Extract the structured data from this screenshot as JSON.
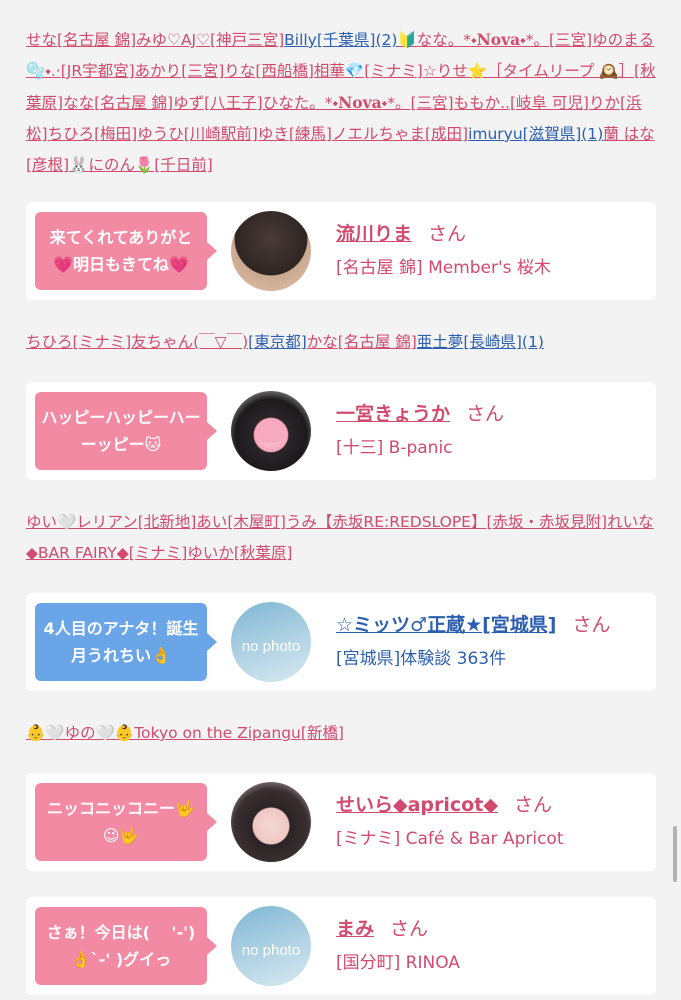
{
  "rows": [
    {
      "names": [
        {
          "text": "せな",
          "kind": "plain"
        },
        {
          "text": "[名古屋 錦]",
          "kind": "link"
        },
        {
          "text": "みゆ♡AJ♡",
          "kind": "plain"
        },
        {
          "text": "[神戸三宮]",
          "kind": "link"
        },
        {
          "text": "Billy",
          "kind": "blue"
        },
        {
          "text": "[千葉県]",
          "kind": "blue"
        },
        {
          "text": "(2)",
          "kind": "blue"
        },
        {
          "text": "🔰なな。*⬩",
          "kind": "plain"
        },
        {
          "text": "Nova",
          "kind": "bold"
        },
        {
          "text": "⬩*。",
          "kind": "plain"
        },
        {
          "text": "[三宮]",
          "kind": "link"
        },
        {
          "text": "ゆのまる 🫧⬩.·",
          "kind": "plain"
        },
        {
          "text": "[JR宇都宮]",
          "kind": "link"
        },
        {
          "text": "あかり",
          "kind": "plain"
        },
        {
          "text": "[三宮]",
          "kind": "link"
        },
        {
          "text": "りな",
          "kind": "plain"
        },
        {
          "text": "[西船橋]",
          "kind": "link"
        },
        {
          "text": "相華💎",
          "kind": "plain"
        },
        {
          "text": "[ミナミ]",
          "kind": "link"
        },
        {
          "text": "☆りせ⭐",
          "kind": "plain"
        },
        {
          "text": "［タイムリープ 🕰️］",
          "kind": "link"
        },
        {
          "text": "[秋葉原]",
          "kind": "link"
        },
        {
          "text": "なな",
          "kind": "plain"
        },
        {
          "text": "[名古屋 錦]",
          "kind": "link"
        },
        {
          "text": "ゆず",
          "kind": "plain"
        },
        {
          "text": "[八王子]",
          "kind": "link"
        },
        {
          "text": "ひなた。*⬩",
          "kind": "plain"
        },
        {
          "text": "Nova",
          "kind": "bold"
        },
        {
          "text": "⬩*。",
          "kind": "plain"
        },
        {
          "text": "[三宮]",
          "kind": "link"
        },
        {
          "text": "ももか..",
          "kind": "plain"
        },
        {
          "text": "[岐阜 可児]",
          "kind": "link"
        },
        {
          "text": "りか",
          "kind": "plain"
        },
        {
          "text": "[浜松]",
          "kind": "link"
        },
        {
          "text": "ちひろ",
          "kind": "plain"
        },
        {
          "text": "[梅田]",
          "kind": "link"
        },
        {
          "text": "ゆうひ",
          "kind": "plain"
        },
        {
          "text": "[川崎駅前]",
          "kind": "link"
        },
        {
          "text": "ゆき",
          "kind": "plain"
        },
        {
          "text": "[練馬]",
          "kind": "link"
        },
        {
          "text": "ノエルちゃま",
          "kind": "plain"
        },
        {
          "text": "[成田]",
          "kind": "link"
        },
        {
          "text": "imuryu",
          "kind": "blue"
        },
        {
          "text": "[滋賀県]",
          "kind": "blue"
        },
        {
          "text": "(1)",
          "kind": "blue"
        },
        {
          "text": "蘭 はな",
          "kind": "plain"
        },
        {
          "text": "[彦根]",
          "kind": "link"
        },
        {
          "text": "🐰にのん🌷",
          "kind": "plain"
        },
        {
          "text": "[千日前]",
          "kind": "link"
        }
      ],
      "card": {
        "bubble_text": "来てくれてありがと💗明日もきてね💗",
        "bubble_color": "pink",
        "avatar_type": "photo-1",
        "name": "流川りま",
        "name_color": "pink",
        "san": "さん",
        "shop": "[名古屋 錦] Member's 桜木",
        "shop_color": "pink"
      }
    },
    {
      "names": [
        {
          "text": "ちひろ",
          "kind": "plain"
        },
        {
          "text": "[ミナミ]",
          "kind": "link"
        },
        {
          "text": "友ちゃん(￣▽￣)",
          "kind": "plain"
        },
        {
          "text": "[東京都]",
          "kind": "blue"
        },
        {
          "text": "かな",
          "kind": "plain"
        },
        {
          "text": "[名古屋 錦]",
          "kind": "link"
        },
        {
          "text": "亜土夢",
          "kind": "blue"
        },
        {
          "text": "[長崎県]",
          "kind": "blue"
        },
        {
          "text": "(1)",
          "kind": "blue"
        }
      ],
      "card": {
        "bubble_text": "ハッピーハッピーハーーッピー🐱",
        "bubble_color": "pink",
        "avatar_type": "photo-2",
        "name": "一宮きょうか",
        "name_color": "pink",
        "san": "さん",
        "shop": "[十三] B-panic",
        "shop_color": "pink"
      }
    },
    {
      "names": [
        {
          "text": "ゆい🤍レリアン",
          "kind": "plain"
        },
        {
          "text": "[北新地]",
          "kind": "link"
        },
        {
          "text": "あい",
          "kind": "plain"
        },
        {
          "text": "[木屋町]",
          "kind": "link"
        },
        {
          "text": "うみ【赤坂RE:REDSLOPE】",
          "kind": "plain"
        },
        {
          "text": "[赤坂・赤坂見附]",
          "kind": "link"
        },
        {
          "text": "れいな◆BAR FAIRY◆",
          "kind": "plain"
        },
        {
          "text": "[ミナミ]",
          "kind": "link"
        },
        {
          "text": "ゆいか",
          "kind": "plain"
        },
        {
          "text": "[秋葉原]",
          "kind": "link"
        }
      ],
      "card": {
        "bubble_text": "4人目のアナタ！誕生月うれちい👌",
        "bubble_color": "blue",
        "avatar_type": "nophoto",
        "avatar_text": "no photo",
        "name": "☆ミッツ♂正蔵★[宮城県]",
        "name_color": "blue",
        "san": "さん",
        "shop": "[宮城県]体験談 363件",
        "shop_color": "blue"
      }
    },
    {
      "names": [
        {
          "text": "👶🤍ゆの🤍👶Tokyo on the Zipangu",
          "kind": "plain"
        },
        {
          "text": "[新橋]",
          "kind": "link"
        }
      ],
      "card": {
        "bubble_text": "ニッコニッコニー🤟😉🤟",
        "bubble_color": "pink",
        "avatar_type": "photo-4",
        "name": "せいら◆apricot◆",
        "name_color": "pink",
        "san": "さん",
        "shop": "[ミナミ] Café & Bar Apricot",
        "shop_color": "pink"
      }
    },
    {
      "names": [],
      "card": {
        "bubble_text": "さぁ！今日は( 　'-')👌`-' )グイっ",
        "bubble_color": "pink",
        "avatar_type": "nophoto",
        "avatar_text": "no photo",
        "name": "まみ",
        "name_color": "pink",
        "san": "さん",
        "shop": "[国分町] RINOA",
        "shop_color": "pink"
      }
    }
  ]
}
